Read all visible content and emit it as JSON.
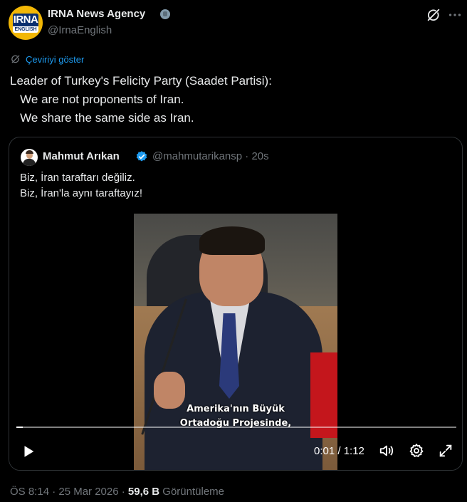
{
  "author": {
    "name": "IRNA News Agency",
    "handle": "@IrnaEnglish",
    "avatar_logo_top": "IRNA",
    "avatar_logo_bottom": "ENGLISH",
    "badge": "government-verified"
  },
  "translate_label": "Çeviriyi göster",
  "tweet_text": "Leader of Turkey's Felicity Party (Saadet Partisi):\n   We are not proponents of Iran.\n   We share the same side as Iran.",
  "quote": {
    "name": "Mahmut Arıkan",
    "handle_time": "@mahmutarikansp · 20s",
    "text": "Biz, İran taraftarı değiliz.\nBiz, İran'la aynı taraftayız!",
    "video": {
      "subtitle": "Amerika'nın Büyük\nOrtadoğu Projesinde,",
      "time": "0:01 / 1:12",
      "progress": 0.014
    }
  },
  "meta": {
    "timestamp": "ÖS 8:14 · 25 Mar 2026 · ",
    "views": "59,6 B",
    "views_label": " Görüntüleme"
  },
  "colors": {
    "accent": "#1d9bf0",
    "muted": "#71767b",
    "text": "#e7e9ea",
    "background": "#000000"
  },
  "icons": [
    "grok-icon",
    "more-icon",
    "translate-icon",
    "verified-icon",
    "play-icon",
    "volume-icon",
    "settings-icon",
    "fullscreen-icon"
  ]
}
